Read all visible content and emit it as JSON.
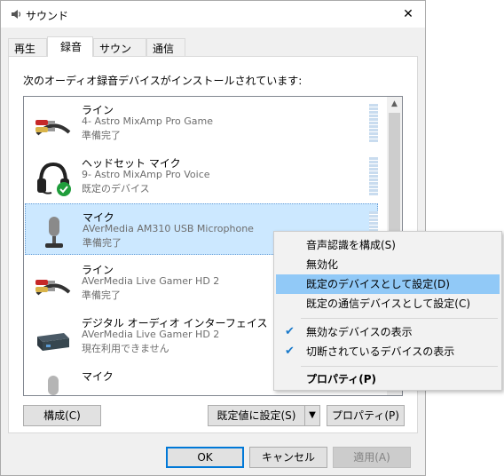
{
  "window": {
    "title": "サウンド"
  },
  "tabs": [
    {
      "label": "再生"
    },
    {
      "label": "録音"
    },
    {
      "label": "サウンド"
    },
    {
      "label": "通信"
    }
  ],
  "intro": "次のオーディオ録音デバイスがインストールされています:",
  "devices": [
    {
      "name": "ライン",
      "sub": "4- Astro MixAmp Pro Game",
      "status": "準備完了",
      "icon": "rca-cable-icon"
    },
    {
      "name": "ヘッドセット マイク",
      "sub": "9- Astro MixAmp Pro Voice",
      "status": "既定のデバイス",
      "icon": "headset-icon"
    },
    {
      "name": "マイク",
      "sub": "AVerMedia AM310 USB Microphone",
      "status": "準備完了",
      "icon": "microphone-icon"
    },
    {
      "name": "ライン",
      "sub": "AVerMedia Live Gamer HD 2",
      "status": "準備完了",
      "icon": "rca-cable-icon"
    },
    {
      "name": "デジタル オーディオ インターフェイス",
      "sub": "AVerMedia Live Gamer HD 2",
      "status": "現在利用できません",
      "icon": "capture-card-icon"
    },
    {
      "name": "マイク",
      "sub": "",
      "status": "",
      "icon": "microphone-icon"
    }
  ],
  "buttons": {
    "configure": "構成(C)",
    "set_default": "既定値に設定(S)",
    "properties": "プロパティ(P)",
    "ok": "OK",
    "cancel": "キャンセル",
    "apply": "適用(A)"
  },
  "context_menu": {
    "items": [
      {
        "label": "音声認識を構成(S)"
      },
      {
        "label": "無効化"
      },
      {
        "label": "既定のデバイスとして設定(D)"
      },
      {
        "label": "既定の通信デバイスとして設定(C)"
      },
      {
        "label": "無効なデバイスの表示",
        "checked": true
      },
      {
        "label": "切断されているデバイスの表示",
        "checked": true
      },
      {
        "label": "プロパティ(P)"
      }
    ]
  },
  "colors": {
    "selection": "#cce8ff",
    "menu_hover": "#91c9f7",
    "check": "#1979ca",
    "accent": "#0078d7"
  }
}
